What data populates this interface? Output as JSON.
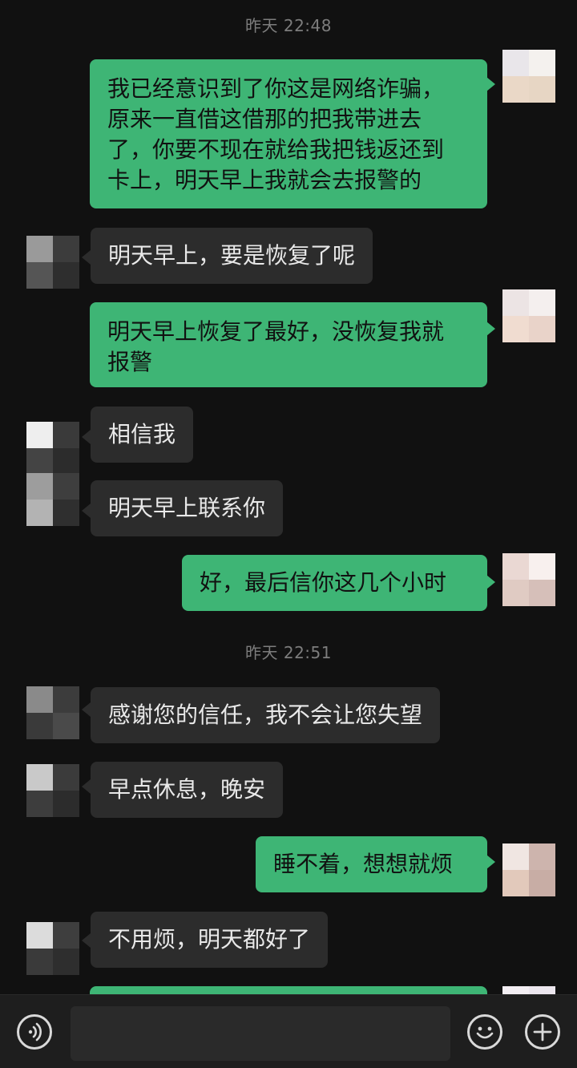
{
  "chat": {
    "timestamps": [
      "昨天 22:48",
      "昨天 22:51"
    ],
    "messages": [
      {
        "side": "out",
        "text": "我已经意识到了你这是网络诈骗，\n原来一直借这借那的把我带进去\n了，你要不现在就给我把钱返还到\n卡上，明天早上我就会去报警的"
      },
      {
        "side": "in",
        "text": "明天早上，要是恢复了呢"
      },
      {
        "side": "out",
        "text": "明天早上恢复了最好，没恢复我就\n报警"
      },
      {
        "side": "in",
        "text": "相信我"
      },
      {
        "side": "in",
        "text": "明天早上联系你"
      },
      {
        "side": "out",
        "text": "好，最后信你这几个小时"
      },
      {
        "side": "in",
        "text": "感谢您的信任，我不会让您失望"
      },
      {
        "side": "in",
        "text": "早点休息，晚安"
      },
      {
        "side": "out",
        "text": "睡不着，想想就烦"
      },
      {
        "side": "in",
        "text": "不用烦，明天都好了"
      }
    ]
  },
  "input_bar": {
    "voice_icon": "voice-icon",
    "emoji_icon": "emoji-icon",
    "more_icon": "plus-icon",
    "input_value": ""
  },
  "colors": {
    "background": "#111111",
    "incoming_bubble": "#2c2c2c",
    "outgoing_bubble": "#3eb575",
    "timestamp_text": "#7d7d7d"
  }
}
